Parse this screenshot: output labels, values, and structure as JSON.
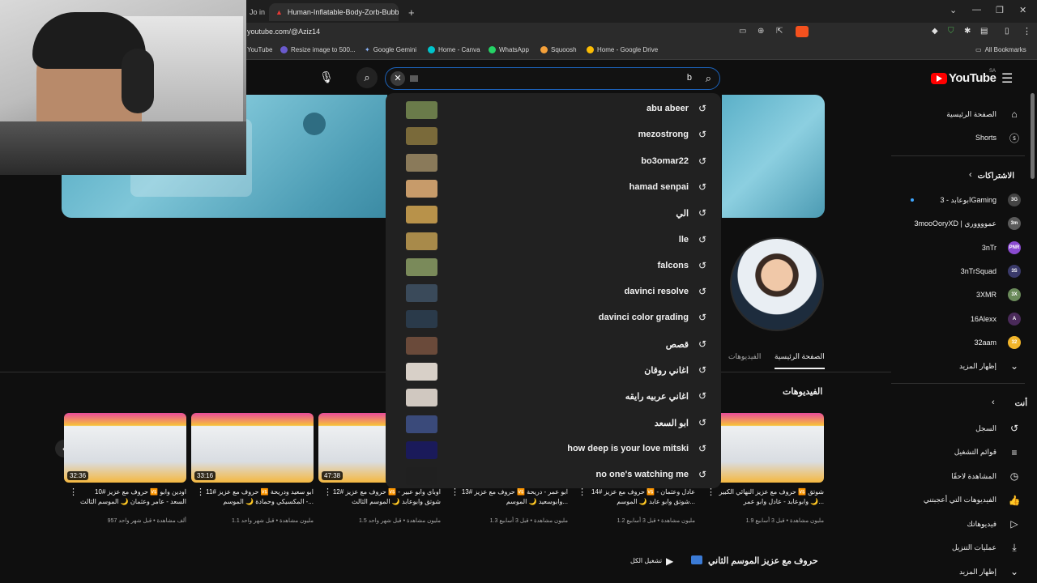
{
  "browser": {
    "tabs": [
      {
        "label": "Jo in"
      },
      {
        "label": "Human-Inflatable-Body-Zorb-Bubble"
      }
    ],
    "url": "youtube.com/@Aziz14",
    "bookmarks": [
      {
        "label": "YouTube"
      },
      {
        "label": "Resize image to 500..."
      },
      {
        "label": "Google Gemini"
      },
      {
        "label": "Home - Canva"
      },
      {
        "label": "WhatsApp"
      },
      {
        "label": "Squoosh"
      },
      {
        "label": "Home - Google Drive"
      }
    ],
    "all_bookmarks": "All Bookmarks"
  },
  "youtube": {
    "logo": "YouTube",
    "region": "SA",
    "search_value": "b"
  },
  "search_history": [
    {
      "text": "abu abeer",
      "thumb": "#6a7b4a"
    },
    {
      "text": "mezostrong",
      "thumb": "#7a6a3a"
    },
    {
      "text": "bo3omar22",
      "thumb": "#8a7a5a"
    },
    {
      "text": "hamad senpai",
      "thumb": "#c79b6a"
    },
    {
      "text": "الي",
      "thumb": "#b8924a"
    },
    {
      "text": "lle",
      "thumb": "#a88a4a"
    },
    {
      "text": "falcons",
      "thumb": "#7a8a5a"
    },
    {
      "text": "davinci resolve",
      "thumb": "#3a4a5a"
    },
    {
      "text": "davinci color grading",
      "thumb": "#2a3a4a"
    },
    {
      "text": "قصص",
      "thumb": "#6a4a3a"
    },
    {
      "text": "اغاني روقان",
      "thumb": "#d8d0c8"
    },
    {
      "text": "اغاني عربيه رايقه",
      "thumb": "#d0c8c0"
    },
    {
      "text": "ابو السعد",
      "thumb": "#3a4a7a"
    },
    {
      "text": "how deep is your love mitski",
      "thumb": "#1a1a5a"
    },
    {
      "text": "no one's watching me",
      "thumb": "#202020"
    }
  ],
  "sidebar": {
    "main": [
      {
        "label": "الصفحة الرئيسية",
        "icon": "home-icon"
      },
      {
        "label": "Shorts",
        "icon": "shorts-icon"
      }
    ],
    "subscriptions_title": "الاشتراكات",
    "subscriptions": [
      {
        "label": "ابوعابد - 3Gaming",
        "color": "#444444",
        "initials": "3G",
        "live": true
      },
      {
        "label": "3mooOoryXD | عمووووري",
        "color": "#5a5a5a",
        "initials": "3m"
      },
      {
        "label": "3nTr",
        "color": "#8a4ad0",
        "initials": "PNR"
      },
      {
        "label": "3nTrSquad",
        "color": "#3a3a6a",
        "initials": "3S"
      },
      {
        "label": "3XMR",
        "color": "#6a8a5a",
        "initials": "3X"
      },
      {
        "label": "16Alexx",
        "color": "#4a2a5a",
        "initials": "A"
      },
      {
        "label": "32aam",
        "color": "#f2b52a",
        "initials": "32"
      }
    ],
    "show_more": "إظهار المزيد",
    "you_title": "أنت",
    "you_items": [
      {
        "label": "السجل",
        "icon": "history-icon"
      },
      {
        "label": "قوائم التشغيل",
        "icon": "playlist-icon"
      },
      {
        "label": "المشاهدة لاحقًا",
        "icon": "clock-icon"
      },
      {
        "label": "الفيديوهات التي أعجبتني",
        "icon": "like-icon"
      },
      {
        "label": "فيديوهاتك",
        "icon": "video-icon"
      },
      {
        "label": "عمليات التنزيل",
        "icon": "download-icon"
      },
      {
        "label": "إظهار المزيد",
        "icon": "chevron-down-icon"
      }
    ]
  },
  "channel": {
    "tabs": [
      "الصفحة الرئيسية",
      "الفيديوهات"
    ],
    "videos_heading": "الفيديوهات",
    "playlist_heading": "حروف مع عزيز الموسم الثاني",
    "play_all": "تشغيل الكل"
  },
  "videos": [
    {
      "duration": "32:36",
      "title": "حروف مع عزيز #10 🆚 اودين وابو السعد - عامر وعثمان 🌙 الموسم الثالث",
      "meta": "957 ألف مشاهدة • قبل شهر واحد"
    },
    {
      "duration": "33:16",
      "title": "حروف مع عزيز #11 🆚 ابو سعيد ودريحة - المكسيكي وحمادة 🌙 الموسم...",
      "meta": "1.1 مليون مشاهدة • قبل شهر واحد"
    },
    {
      "duration": "47:38",
      "title": "حروف مع عزيز #12 🆚 اوباي وابو عبير - شوتق وابوعابد 🌙 الموسم الثالث",
      "meta": "1.5 مليون مشاهدة • قبل شهر واحد"
    },
    {
      "duration": "",
      "title": "حروف مع عزيز #13 🆚 ابو عمر - دريحة وابوسعيد 🌙 الموسم...",
      "meta": "1.3 مليون مشاهدة • قبل 3 أسابيع"
    },
    {
      "duration": "",
      "title": "حروف مع عزيز #14 🆚 عادل وعثمان - شوتق وابو عابد 🌙 الموسم...",
      "meta": "1.2 مليون مشاهدة • قبل 3 أسابيع"
    },
    {
      "duration": "",
      "title": "حروف مع عزيز النهائي الكبير 🆚 شوتق وابوعابد - عادل وابو عمر 🌙...",
      "meta": "1.9 مليون مشاهدة • قبل 3 أسابيع"
    }
  ]
}
